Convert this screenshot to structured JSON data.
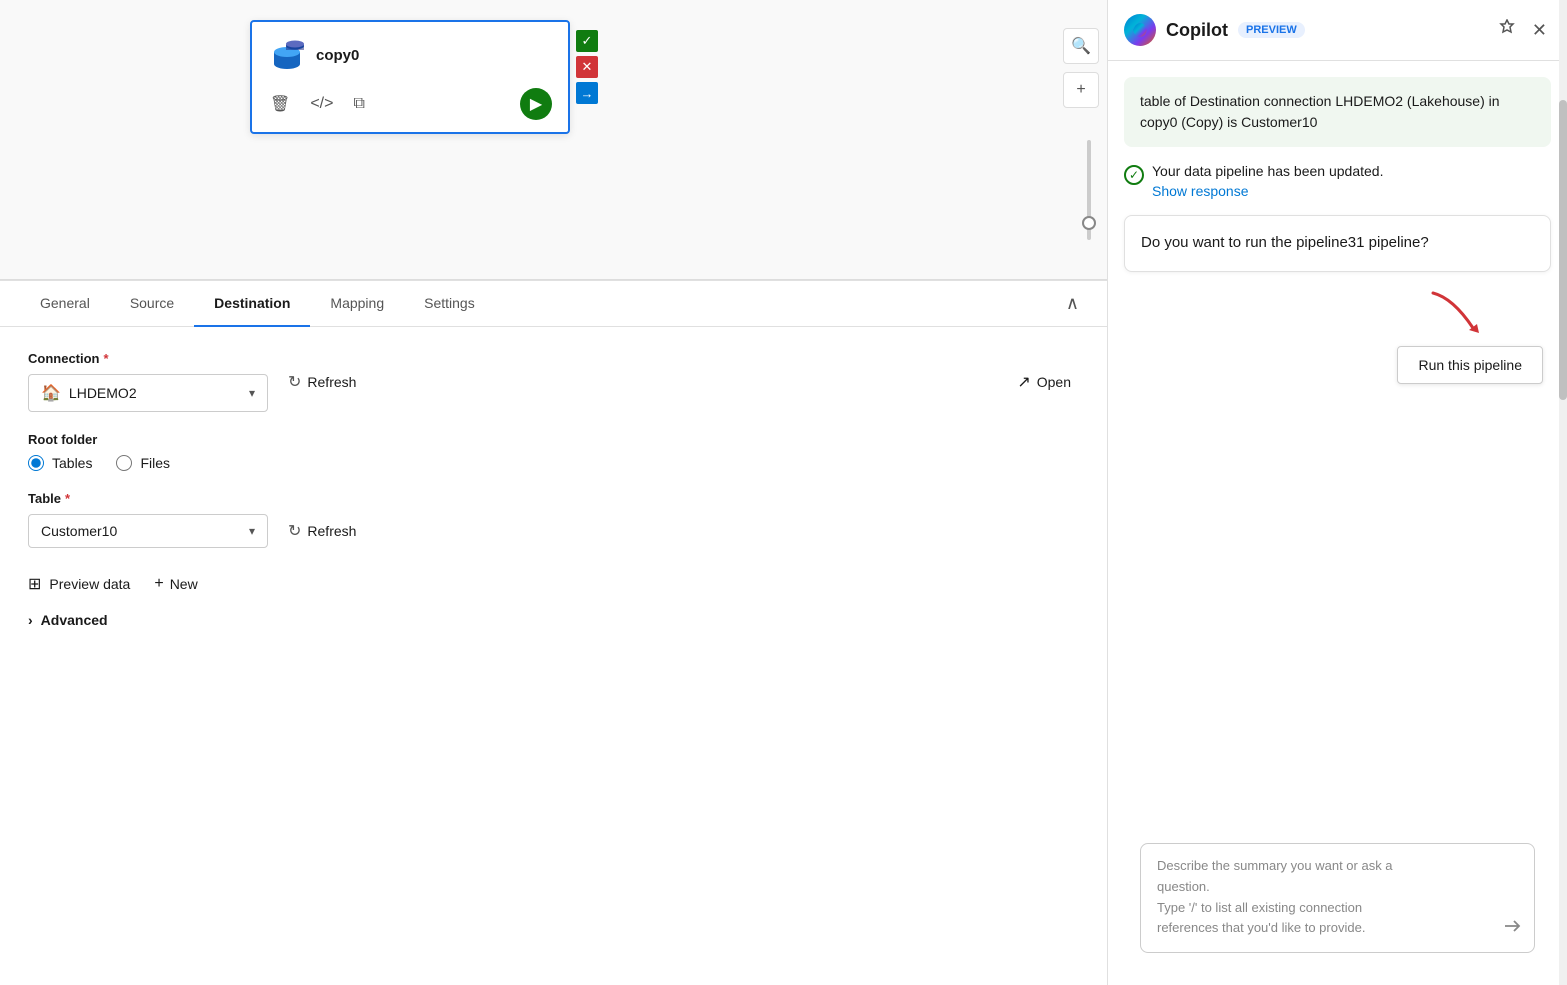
{
  "pipeline": {
    "node_title": "copy0",
    "node_icon": "database"
  },
  "config": {
    "tabs": [
      {
        "label": "General",
        "active": false
      },
      {
        "label": "Source",
        "active": false
      },
      {
        "label": "Destination",
        "active": true
      },
      {
        "label": "Mapping",
        "active": false
      },
      {
        "label": "Settings",
        "active": false
      }
    ],
    "connection_label": "Connection",
    "connection_value": "LHDEMO2",
    "open_label": "Open",
    "refresh_label": "Refresh",
    "root_folder_label": "Root folder",
    "tables_label": "Tables",
    "files_label": "Files",
    "table_label": "Table",
    "table_value": "Customer10",
    "preview_data_label": "Preview data",
    "new_label": "New",
    "advanced_label": "Advanced"
  },
  "copilot": {
    "title": "Copilot",
    "preview_badge": "PREVIEW",
    "message_bubble": "table of Destination connection LHDEMO2 (Lakehouse) in copy0 (Copy) is Customer10",
    "updated_text": "Your data pipeline has been updated.",
    "show_response": "Show response",
    "question_text": "Do you want to run the pipeline31 pipeline?",
    "run_pipeline_label": "Run this pipeline",
    "input_placeholder_line1": "Describe the summary you want or ask a",
    "input_placeholder_line2": "question.",
    "input_placeholder_line3": "Type '/' to list all existing connection",
    "input_placeholder_line4": "references that you'd like to provide."
  }
}
